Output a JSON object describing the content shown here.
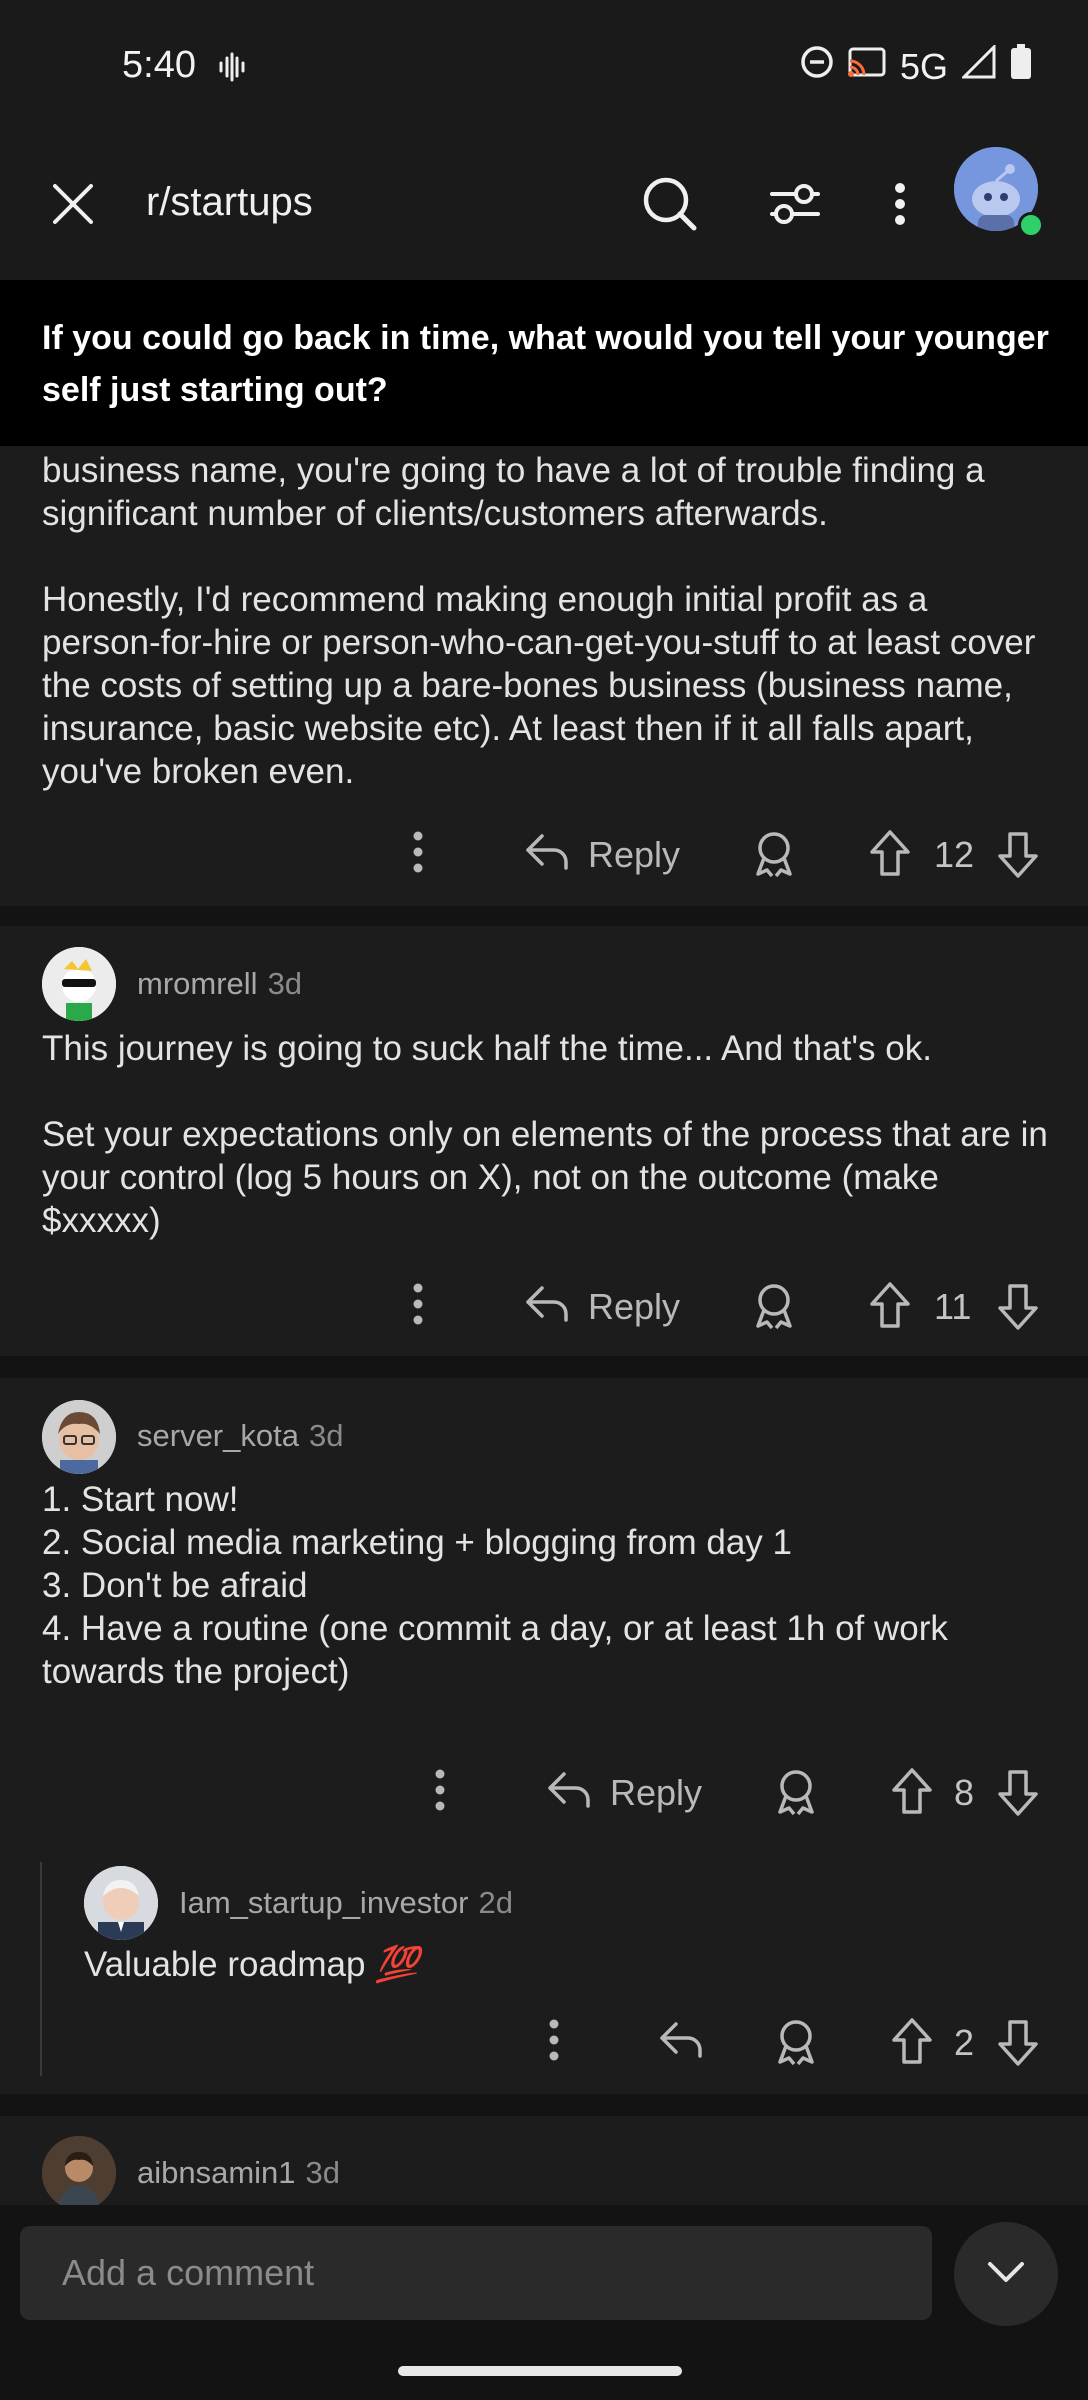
{
  "status_bar": {
    "time": "5:40",
    "network": "5G"
  },
  "header": {
    "subreddit": "r/startups"
  },
  "post": {
    "title": "If you could go back in time, what would you tell your younger self just starting out?"
  },
  "comments": [
    {
      "text": "business name, you're going to have a lot of trouble finding a significant number of clients/customers afterwards.\n\nHonestly, I'd recommend making enough initial profit as a person-for-hire or person-who-can-get-you-stuff to at least cover the costs of setting up a bare-bones business (business name, insurance, basic website etc). At least then if it all falls apart, you've broken even.",
      "reply_label": "Reply",
      "score": "12"
    },
    {
      "username": "mromrell",
      "age": "3d",
      "text": "This journey is going to suck half the time... And that's ok.\n\nSet your expectations only on elements of the process that are in your control (log 5 hours on X), not on the outcome (make $xxxxx)",
      "reply_label": "Reply",
      "score": "11"
    },
    {
      "username": "server_kota",
      "age": "3d",
      "text": "1. Start now!\n2. Social media marketing + blogging from day 1\n3. Don't be afraid\n4. Have a routine (one commit a day, or at least 1h of work towards the project)",
      "reply_label": "Reply",
      "score": "8",
      "replies": [
        {
          "username": "Iam_startup_investor",
          "age": "2d",
          "text": "Valuable roadmap",
          "emoji": "💯",
          "score": "2"
        }
      ]
    },
    {
      "username": "aibnsamin1",
      "age": "3d"
    }
  ],
  "composer": {
    "placeholder": "Add a comment"
  },
  "colors": {
    "background": "#131314",
    "card": "#1c1c1d",
    "title_bar": "#000000",
    "online": "#2fcf6a",
    "emoji_red": "#e0332e"
  }
}
